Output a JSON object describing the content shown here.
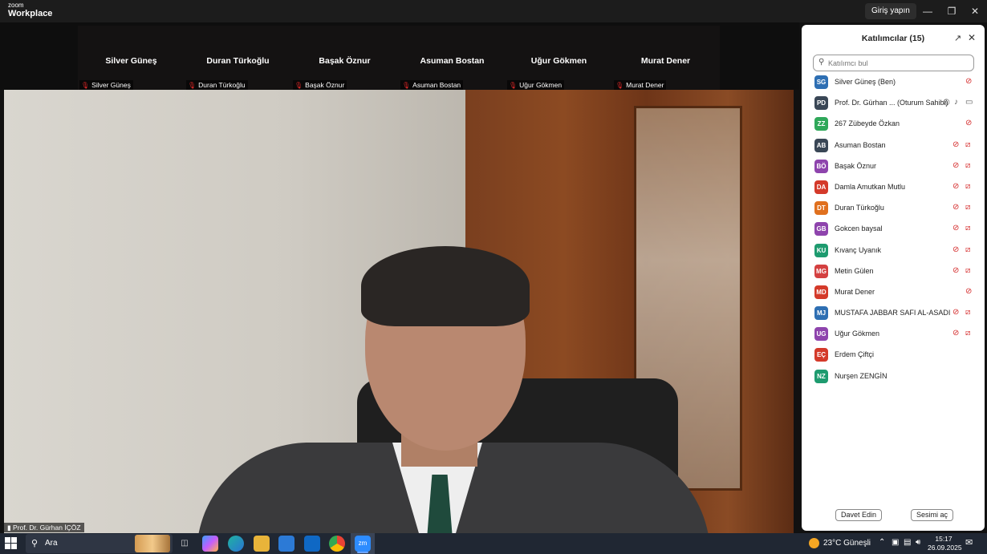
{
  "app": {
    "brand_line1": "zoom",
    "brand_line2": "Workplace",
    "signin_label": "Giriş yapın"
  },
  "gallery": {
    "tiles": [
      {
        "name": "Silver Güneş",
        "label": "Silver Güneş"
      },
      {
        "name": "Duran Türkoğlu",
        "label": "Duran Türkoğlu"
      },
      {
        "name": "Başak Öznur",
        "label": "Başak Öznur"
      },
      {
        "name": "Asuman Bostan",
        "label": "Asuman Bostan"
      },
      {
        "name": "Uğur Gökmen",
        "label": "Uğur Gökmen"
      },
      {
        "name": "Murat Dener",
        "label": "Murat Dener"
      }
    ]
  },
  "main_video": {
    "speaker_label": "Prof. Dr. Gürhan İÇÖZ"
  },
  "participants_panel": {
    "title": "Katılımcılar (15)",
    "search_placeholder": "Katılımcı bul",
    "invite_label": "Davet Edin",
    "unmute_label": "Sesimi aç",
    "participants": [
      {
        "initials": "SG",
        "name": "Silver Güneş (Ben)",
        "color": "#2e6fb3",
        "mic_muted": true,
        "cam_off": false
      },
      {
        "initials": "PD",
        "name": "Prof. Dr. Gürhan ... (Oturum Sahibi)",
        "color": "#3a4756",
        "mic_muted": false,
        "cam_off": false,
        "host": true
      },
      {
        "initials": "ZZ",
        "name": "267 Zübeyde Özkan",
        "color": "#2fa85a",
        "mic_muted": true,
        "cam_off": false
      },
      {
        "initials": "AB",
        "name": "Asuman Bostan",
        "color": "#3a4756",
        "mic_muted": true,
        "cam_off": true
      },
      {
        "initials": "BÖ",
        "name": "Başak Öznur",
        "color": "#8e44ad",
        "mic_muted": true,
        "cam_off": true
      },
      {
        "initials": "DA",
        "name": "Damla Amutkan Mutlu",
        "color": "#d43a2a",
        "mic_muted": true,
        "cam_off": true
      },
      {
        "initials": "DT",
        "name": "Duran Türkoğlu",
        "color": "#e0701e",
        "mic_muted": true,
        "cam_off": true
      },
      {
        "initials": "GB",
        "name": "Gokcen baysal",
        "color": "#8e44ad",
        "mic_muted": true,
        "cam_off": true
      },
      {
        "initials": "KU",
        "name": "Kıvanç Uyanık",
        "color": "#1e9b6f",
        "mic_muted": true,
        "cam_off": true
      },
      {
        "initials": "MG",
        "name": "Metin Gülen",
        "color": "#d44040",
        "mic_muted": true,
        "cam_off": true
      },
      {
        "initials": "MD",
        "name": "Murat Dener",
        "color": "#d43a2a",
        "mic_muted": true,
        "cam_off": false
      },
      {
        "initials": "MJ",
        "name": "MUSTAFA JABBAR SAFI AL-ASADI",
        "color": "#2e6fb3",
        "mic_muted": true,
        "cam_off": true
      },
      {
        "initials": "UG",
        "name": "Uğur Gökmen",
        "color": "#8e44ad",
        "mic_muted": true,
        "cam_off": true
      },
      {
        "initials": "EÇ",
        "name": "Erdem Çiftçi",
        "color": "#d43a2a",
        "mic_muted": false,
        "cam_off": false
      },
      {
        "initials": "NZ",
        "name": "Nurşen ZENGİN",
        "color": "#1e9b6f",
        "mic_muted": false,
        "cam_off": false
      }
    ]
  },
  "taskbar": {
    "search_text": "Ara",
    "weather": "23°C  Güneşli",
    "time": "15:17",
    "date": "26.09.2025",
    "zoom_app_label": "zm"
  }
}
